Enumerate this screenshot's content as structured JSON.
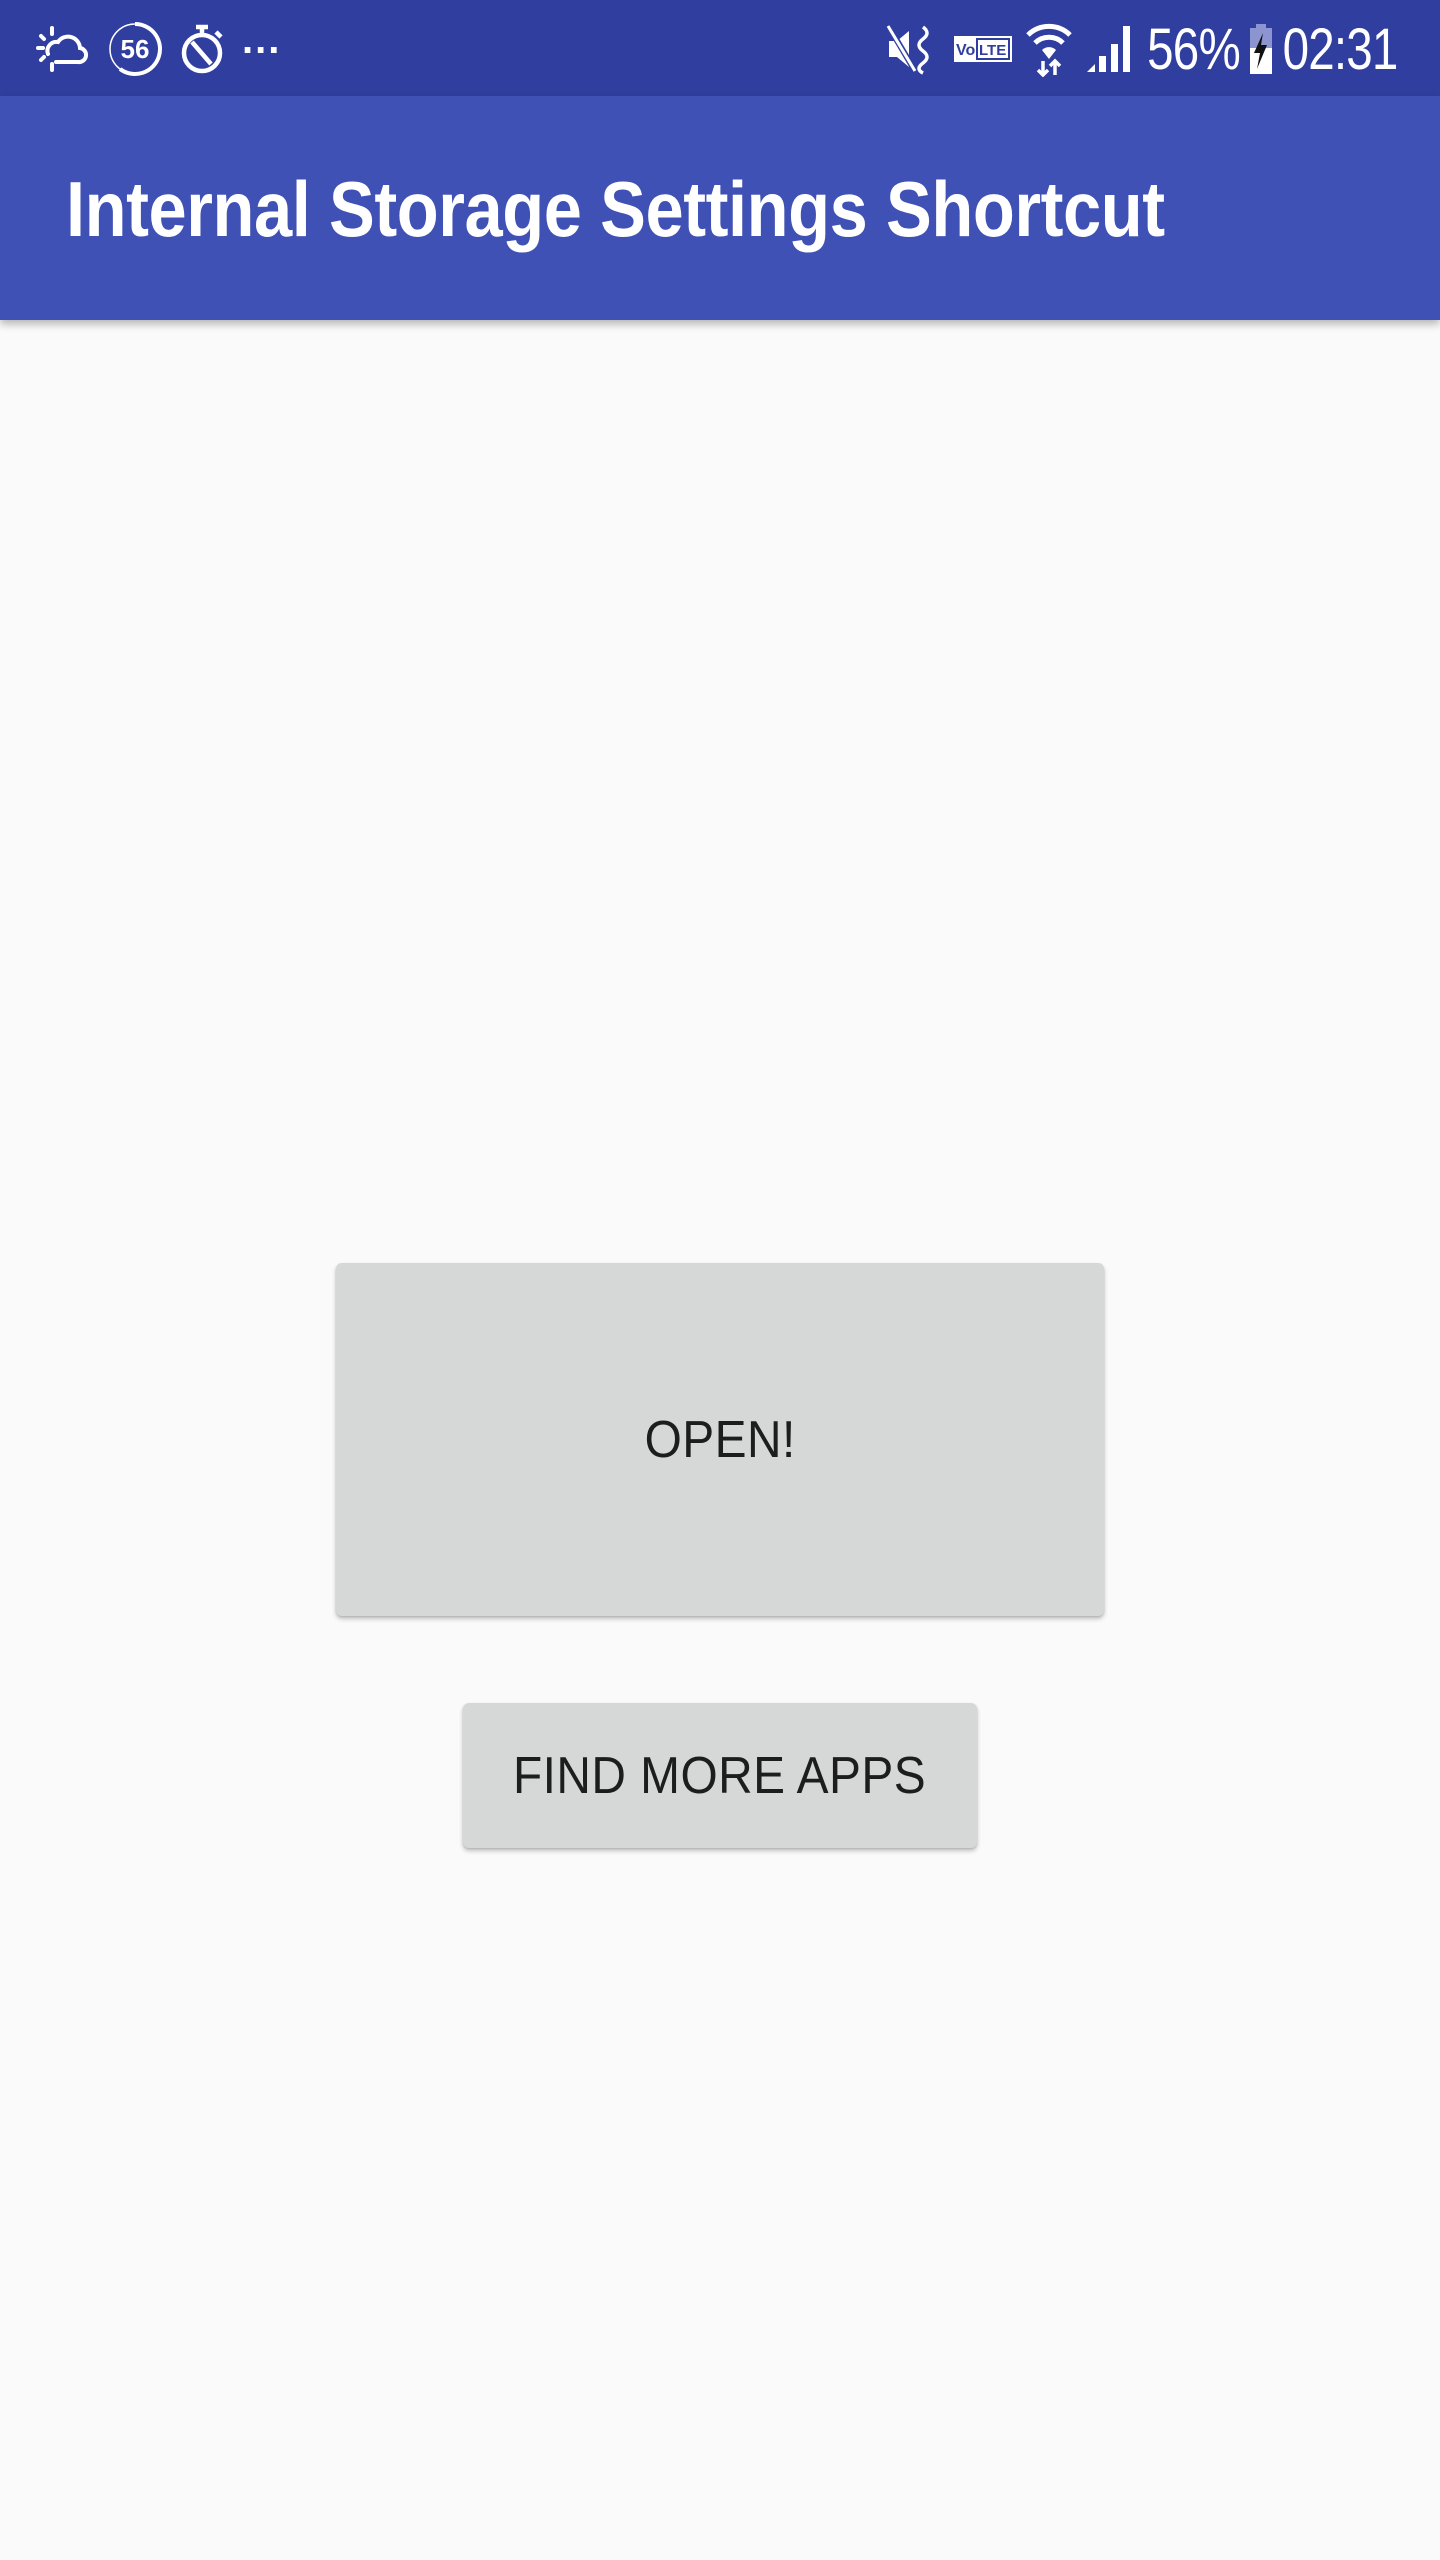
{
  "status_bar": {
    "left_icons": [
      "weather-partly-cloudy-icon",
      "notification-count-icon",
      "stopwatch-icon",
      "more-notifications-icon"
    ],
    "notification_count": "56",
    "ellipsis": "...",
    "right_icons": [
      "mute-vibrate-icon",
      "volte-icon",
      "wifi-icon",
      "cell-signal-icon",
      "battery-charging-icon"
    ],
    "volte_label": "VoLTE",
    "battery_percent": "56%",
    "time": "02:31"
  },
  "app_bar": {
    "title": "Internal Storage Settings Shortcut"
  },
  "main": {
    "open_button_label": "OPEN!",
    "find_more_apps_label": "FIND MORE APPS"
  },
  "colors": {
    "status_bar": "#303f9f",
    "primary": "#3f51b5",
    "background": "#fafafa",
    "button": "#d6d7d7",
    "button_text": "#1d1d1d"
  }
}
